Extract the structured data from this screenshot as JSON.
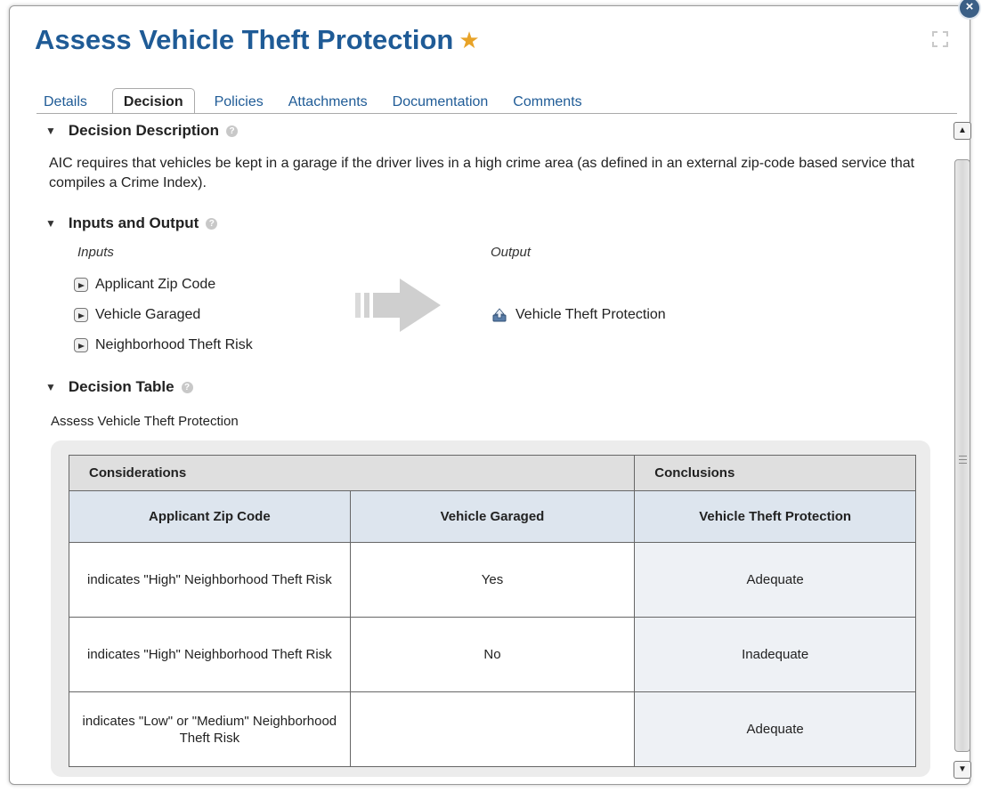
{
  "dialog": {
    "title": "Assess Vehicle Theft Protection",
    "close_glyph": "×"
  },
  "tabs": [
    {
      "label": "Details",
      "active": false
    },
    {
      "label": "Decision",
      "active": true
    },
    {
      "label": "Policies",
      "active": false
    },
    {
      "label": "Attachments",
      "active": false
    },
    {
      "label": "Documentation",
      "active": false
    },
    {
      "label": "Comments",
      "active": false
    }
  ],
  "description": {
    "heading": "Decision Description",
    "text": "AIC requires that vehicles be kept in a garage if the driver lives in a high crime area (as defined in an external zip-code based service that compiles a Crime Index)."
  },
  "io": {
    "heading": "Inputs and Output",
    "inputs_label": "Inputs",
    "output_label": "Output",
    "inputs": [
      "Applicant Zip Code",
      "Vehicle Garaged",
      "Neighborhood Theft Risk"
    ],
    "output": "Vehicle Theft Protection"
  },
  "decision_table": {
    "heading": "Decision Table",
    "caption": "Assess Vehicle Theft Protection",
    "group_considerations": "Considerations",
    "group_conclusions": "Conclusions",
    "columns": [
      "Applicant Zip Code",
      "Vehicle Garaged",
      "Vehicle Theft Protection"
    ],
    "rows": [
      [
        "indicates \"High\" Neighborhood Theft Risk",
        "Yes",
        "Adequate"
      ],
      [
        "indicates \"High\" Neighborhood Theft Risk",
        "No",
        "Inadequate"
      ],
      [
        "indicates \"Low\" or \"Medium\" Neighborhood Theft Risk",
        "",
        "Adequate"
      ]
    ]
  },
  "colors": {
    "title": "#1f5b96",
    "star": "#e8a328",
    "column_header_bg": "#dde5ee",
    "group_header_bg": "#dfdfdf"
  }
}
